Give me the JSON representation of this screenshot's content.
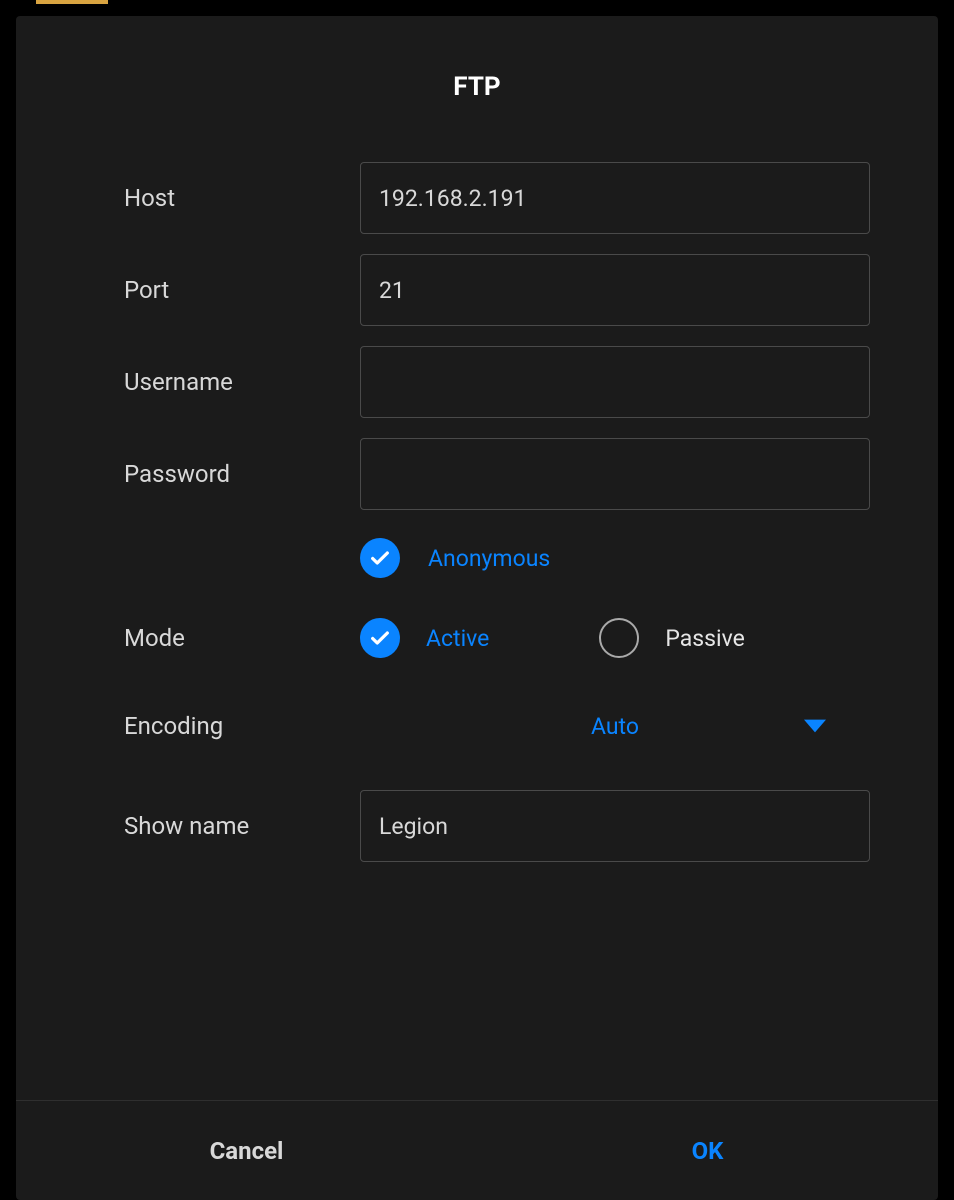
{
  "dialog": {
    "title": "FTP",
    "fields": {
      "host_label": "Host",
      "host_value": "192.168.2.191",
      "port_label": "Port",
      "port_value": "21",
      "username_label": "Username",
      "username_value": "",
      "password_label": "Password",
      "password_value": "",
      "anonymous_label": "Anonymous",
      "anonymous_checked": true,
      "mode_label": "Mode",
      "mode_options": {
        "active": "Active",
        "passive": "Passive"
      },
      "mode_selected": "active",
      "encoding_label": "Encoding",
      "encoding_value": "Auto",
      "showname_label": "Show name",
      "showname_value": "Legion"
    },
    "buttons": {
      "cancel": "Cancel",
      "ok": "OK"
    }
  },
  "colors": {
    "accent": "#0a84ff",
    "bg": "#1b1b1b",
    "text": "#d8d8d8",
    "border": "#4a4a4a"
  }
}
